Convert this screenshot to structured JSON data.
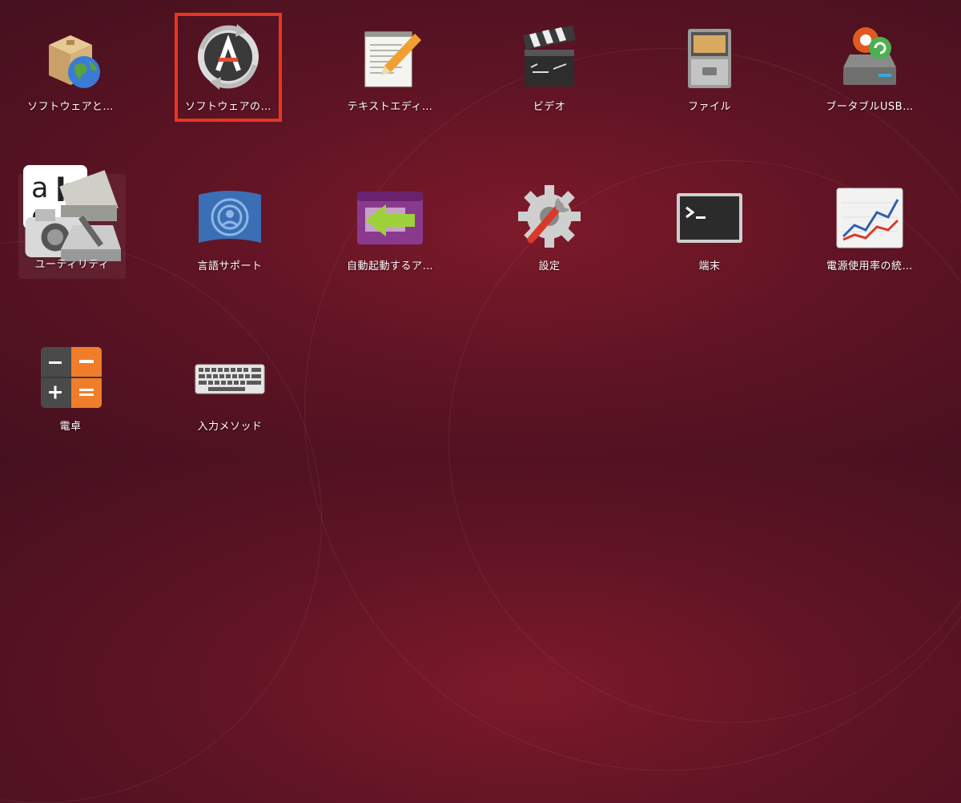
{
  "apps": [
    {
      "id": "software-and-updates",
      "label": "ソフトウェアと…"
    },
    {
      "id": "software-updater",
      "label": "ソフトウェアの…"
    },
    {
      "id": "text-editor",
      "label": "テキストエディ…"
    },
    {
      "id": "videos",
      "label": "ビデオ"
    },
    {
      "id": "files",
      "label": "ファイル"
    },
    {
      "id": "startup-disk-creator",
      "label": "ブータブルUSB…"
    },
    {
      "id": "utilities-folder",
      "label": "ユーティリティ"
    },
    {
      "id": "language-support",
      "label": "言語サポート"
    },
    {
      "id": "startup-applications",
      "label": "自動起動するア…"
    },
    {
      "id": "settings",
      "label": "設定"
    },
    {
      "id": "terminal",
      "label": "端末"
    },
    {
      "id": "power-statistics",
      "label": "電源使用率の統…"
    },
    {
      "id": "calculator",
      "label": "電卓"
    },
    {
      "id": "input-method",
      "label": "入力メソッド"
    }
  ],
  "selected_app": "software-updater",
  "colors": {
    "highlight": "#e8361f",
    "background": "#5f1424"
  }
}
